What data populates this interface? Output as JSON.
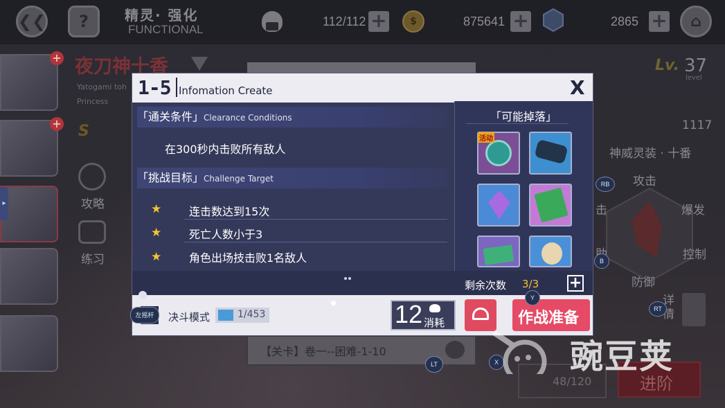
{
  "topbar": {
    "back_icon": "back-arrows-icon",
    "help_label": "?",
    "screen_title": "精灵· 强化",
    "screen_subtitle": "FUNCTIONAL",
    "stamina": "112/112",
    "gold": "875641",
    "crystal": "2865"
  },
  "character": {
    "name": "夜刀神十香",
    "romaji": "Yatogami toh",
    "rank": "Princess",
    "level_prefix": "Lv.",
    "level": "37",
    "level_caption": "level",
    "power": "1117",
    "spirit_outfit": "神威灵装 · 十番",
    "stat_attack": "攻击",
    "stat_burst": "爆发",
    "stat_control": "控制",
    "stat_defense": "防御",
    "stat_left1": "击",
    "stat_left2": "助",
    "detail_label": "详情",
    "sidebar_strategy": "攻略",
    "sidebar_practice": "练习",
    "stage_label": "【关卡】卷一--困难-1-10",
    "advance_label": "进阶",
    "dust_count": "48/120"
  },
  "modal": {
    "stage_number": "1-5",
    "title": "Infomation Create",
    "close_label": "X",
    "clearance": {
      "title_cn": "「通关条件」",
      "title_en": "Clearance Conditions",
      "text": "在300秒内击败所有敌人"
    },
    "challenge": {
      "title_cn": "「挑战目标」",
      "title_en": "Challenge Target",
      "items": [
        "连击数达到15次",
        "死亡人数小于3",
        "角色出场技击败1名敌人"
      ]
    },
    "drops": {
      "title": "「可能掉落」",
      "event_tag": "活动"
    },
    "remaining_label": "剩余次数",
    "remaining_value": "3/3",
    "mode_label": "决斗模式",
    "ticket_count": "1/453",
    "cost_value": "12",
    "cost_label": "消耗",
    "prepare_label": "作战准备"
  },
  "controller": {
    "rb": "RB",
    "b": "B",
    "rt": "RT",
    "y": "Y",
    "x": "X",
    "lt": "LT",
    "stick": "左摇杆"
  },
  "watermark": "豌豆荚"
}
